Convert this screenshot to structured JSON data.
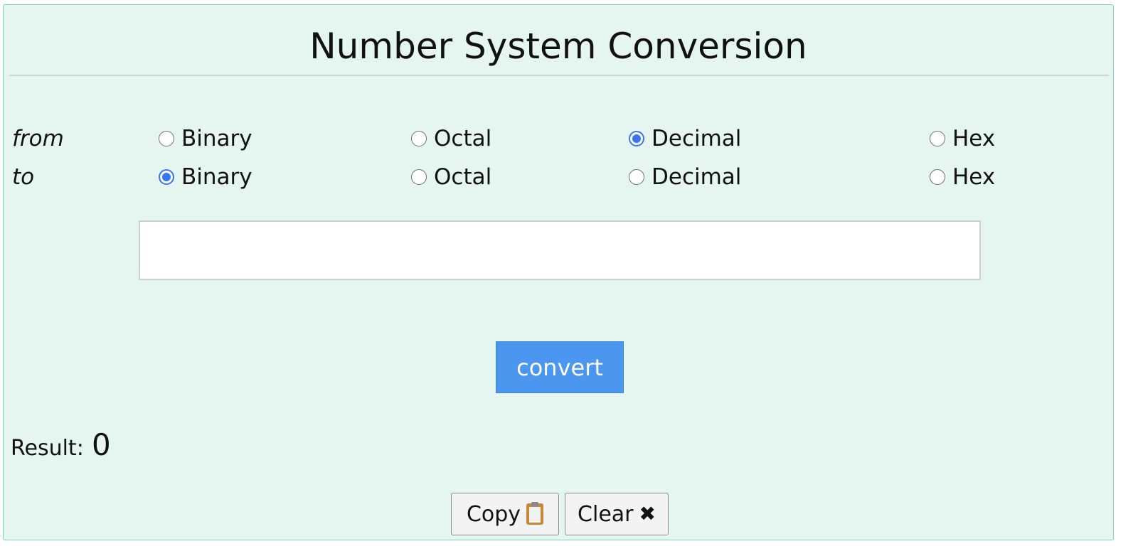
{
  "title": "Number System Conversion",
  "from_label": "from",
  "to_label": "to",
  "from_options": [
    {
      "label": "Binary",
      "checked": false
    },
    {
      "label": "Octal",
      "checked": false
    },
    {
      "label": "Decimal",
      "checked": true
    },
    {
      "label": "Hex",
      "checked": false
    }
  ],
  "to_options": [
    {
      "label": "Binary",
      "checked": true
    },
    {
      "label": "Octal",
      "checked": false
    },
    {
      "label": "Decimal",
      "checked": false
    },
    {
      "label": "Hex",
      "checked": false
    }
  ],
  "input": {
    "value": "",
    "placeholder": ""
  },
  "convert_label": "convert",
  "result": {
    "label": "Result:",
    "value": "0"
  },
  "copy_label": "Copy",
  "clear_label": "Clear",
  "icons": {
    "copy": "clipboard-icon",
    "clear": "x-icon",
    "clear_glyph": "✖"
  },
  "colors": {
    "panel_bg": "#e5f5ef",
    "panel_border": "#7fd3ad",
    "accent": "#3776f2",
    "convert_bg": "#4b96ee"
  }
}
